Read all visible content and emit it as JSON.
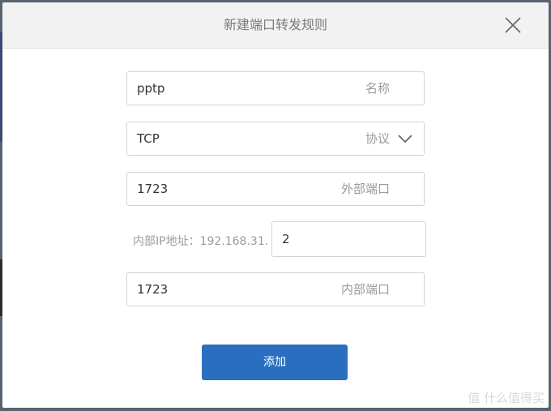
{
  "dialog": {
    "title": "新建端口转发规则",
    "close_icon": "close-icon"
  },
  "form": {
    "name_value": "pptp",
    "name_hint": "名称",
    "protocol_value": "TCP",
    "protocol_hint": "协议",
    "external_port_value": "1723",
    "external_port_hint": "外部端口",
    "internal_ip_label": "内部IP地址：192.168.31.",
    "internal_ip_value": "2",
    "internal_port_value": "1723",
    "internal_port_hint": "内部端口"
  },
  "actions": {
    "add_label": "添加"
  },
  "watermark": {
    "text": "值 什么值得买"
  },
  "colors": {
    "primary_button": "#2a6fbf",
    "header_bg": "#f2f2f2"
  }
}
